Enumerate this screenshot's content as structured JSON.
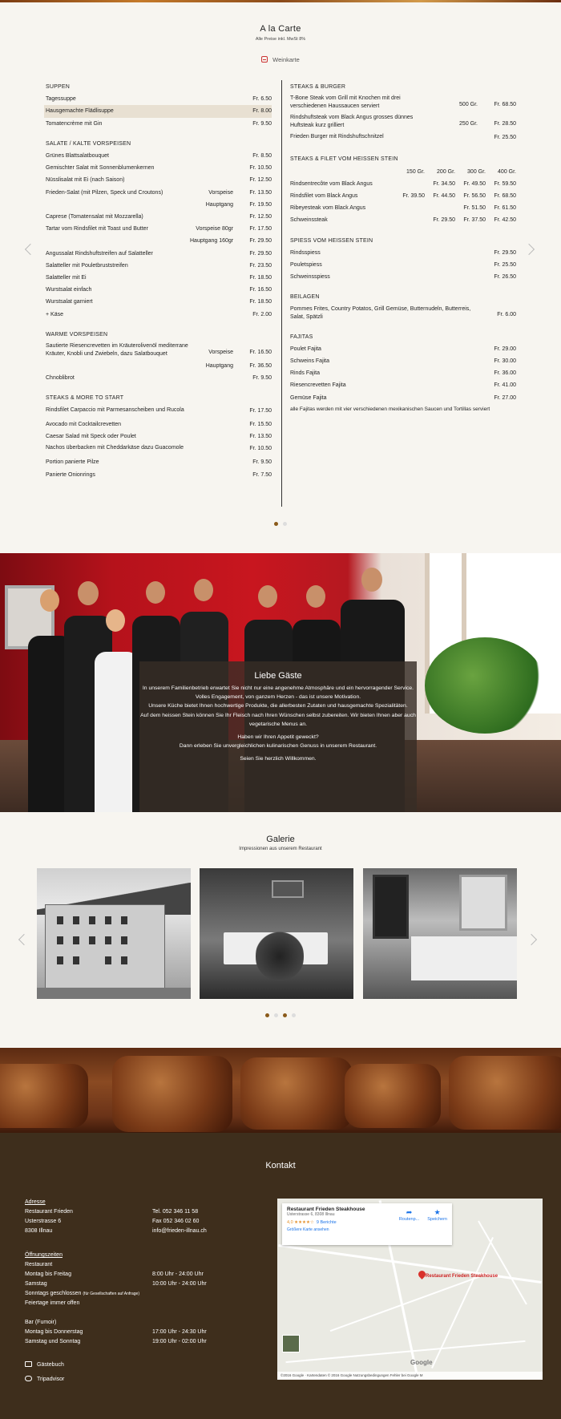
{
  "menu": {
    "title": "A la Carte",
    "subtitle": "Alle Preise inkl. MwSt 8%",
    "wine_link": "Weinkarte",
    "left": [
      {
        "heading": "SUPPEN",
        "rows": [
          {
            "name": "Tagessuppe",
            "price": "Fr.  6.50"
          },
          {
            "name": "Hausgemachte Flädlisuppe",
            "price": "Fr.  8.00",
            "highlight": true
          },
          {
            "name": "Tomatencrème mit Gin",
            "price": "Fr.  9.50"
          }
        ]
      },
      {
        "heading": "SALATE / KALTE VORSPEISEN",
        "rows": [
          {
            "name": "Grünes Blattsalatbouquet",
            "price": "Fr.  8.50"
          },
          {
            "name": "Gemischter Salat mit Sonnenblumenkernen",
            "price": "Fr. 10.50"
          },
          {
            "name": "Nüsslisalat mit Ei (nach Saison)",
            "price": "Fr. 12.50"
          },
          {
            "name": "Frieden-Salat (mit Pilzen, Speck und Croutons)",
            "variant": "Vorspeise",
            "price": "Fr. 13.50"
          },
          {
            "name": "",
            "variant": "Hauptgang",
            "price": "Fr. 19.50"
          },
          {
            "name": "Caprese (Tomatensalat mit Mozzarella)",
            "price": "Fr. 12.50"
          },
          {
            "name": "Tartar vom Rindsfilet mit Toast und Butter",
            "variant": "Vorspeise  80gr",
            "price": "Fr. 17.50"
          },
          {
            "name": "",
            "variant": "Hauptgang 160gr",
            "price": "Fr. 29.50"
          },
          {
            "name": "Angussalat Rindshuftstreifen auf Salatteller",
            "price": "Fr. 29.50"
          },
          {
            "name": "Salatteller mit Pouletbruststreifen",
            "price": "Fr. 23.50"
          },
          {
            "name": "Salatteller mit Ei",
            "price": "Fr. 18.50"
          },
          {
            "name": "Wurstsalat einfach",
            "price": "Fr. 16.50"
          },
          {
            "name": "Wurstsalat garniert",
            "price": "Fr. 18.50"
          },
          {
            "name": "+ Käse",
            "price": "Fr.  2.00"
          }
        ]
      },
      {
        "heading": "WARME VORSPEISEN",
        "rows": [
          {
            "name": "Sautierte Riesencrevetten im Kräuterolivenöl mediterrane Kräuter, Knobli und Zwiebeln, dazu Salatbouquet",
            "variant": "Vorspeise",
            "price": "Fr. 16.50",
            "multiline": true
          },
          {
            "name": "",
            "variant": "Hauptgang",
            "price": "Fr. 36.50"
          },
          {
            "name": "Chnoblibrot",
            "price": "Fr.  9.50"
          }
        ]
      },
      {
        "heading": "STEAKS & MORE TO START",
        "rows": [
          {
            "name": "Rindsfilet Carpaccio mit Parmesanscheiben und Rucola",
            "price": "Fr. 17.50",
            "multiline": true
          },
          {
            "name": "Avocado mit Cocktailcrevetten",
            "price": "Fr. 15.50"
          },
          {
            "name": "Caesar Salad mit Speck oder Poulet",
            "price": "Fr. 13.50"
          },
          {
            "name": "Nachos überbacken mit Cheddarkäse dazu Guacomole",
            "price": "Fr. 10.50",
            "multiline": true
          },
          {
            "name": "Portion panierte Pilze",
            "price": "Fr.  9.50"
          },
          {
            "name": "Panierte Onionrings",
            "price": "Fr.  7.50"
          }
        ]
      }
    ],
    "right": [
      {
        "heading": "STEAKS & BURGER",
        "rows": [
          {
            "name": "T-Bone Steak vom Grill mit Knochen mit drei verschiedenen Haussaucen serviert",
            "variant": "500 Gr.",
            "price": "Fr. 68.50",
            "multiline": true
          },
          {
            "name": "Rindshuftsteak vom Black Angus grosses dünnes Huftsteak kurz grilliert",
            "variant": "250 Gr.",
            "price": "Fr. 28.50",
            "multiline": true
          },
          {
            "name": "Frieden Burger mit Rindshuftschnitzel",
            "price": "Fr. 25.50",
            "multiline": true
          }
        ]
      },
      {
        "heading": "STEAKS & FILET VOM HEISSEN STEIN",
        "sizes": [
          "150 Gr.",
          "200 Gr.",
          "300 Gr.",
          "400 Gr."
        ],
        "rows4": [
          {
            "name": "Rindsentrecôte vom Black Angus",
            "p": [
              "",
              "Fr. 34.50",
              "Fr. 49.50",
              "Fr. 59.50"
            ]
          },
          {
            "name": "Rindsfilet vom Black Angus",
            "p": [
              "Fr. 39.50",
              "Fr. 44.50",
              "Fr. 56.50",
              "Fr. 68.50"
            ]
          },
          {
            "name": "Ribeyesteak vom Black Angus",
            "p": [
              "",
              "",
              "Fr. 51.50",
              "Fr. 61.50"
            ]
          },
          {
            "name": "Schweinssteak",
            "p": [
              "",
              "Fr. 29.50",
              "Fr. 37.50",
              "Fr. 42.50"
            ]
          }
        ]
      },
      {
        "heading": "SPIESS VOM HEISSEN STEIN",
        "rows": [
          {
            "name": "Rindsspiess",
            "price": "Fr. 29.50"
          },
          {
            "name": "Pouletspiess",
            "price": "Fr. 25.50"
          },
          {
            "name": "Schweinsspiess",
            "price": "Fr. 26.50"
          }
        ]
      },
      {
        "heading": "BEILAGEN",
        "rows": [
          {
            "name": "Pommes Frites, Country Potatos, Grill Gemüse, Butternudeln, Butterreis, Salat, Spätzli",
            "price": "Fr.  6.00",
            "multiline": true
          }
        ]
      },
      {
        "heading": "FAJITAS",
        "rows": [
          {
            "name": "Poulet Fajita",
            "price": "Fr. 29.00"
          },
          {
            "name": "Schweins Fajita",
            "price": "Fr. 30.00"
          },
          {
            "name": "Rinds Fajita",
            "price": "Fr. 36.00"
          },
          {
            "name": "Riesencrevetten Fajita",
            "price": "Fr. 41.00"
          },
          {
            "name": "Gemüse Fajita",
            "price": "Fr. 27.00"
          }
        ],
        "note": "alle Fajitas werden mit vier verschiedenen mexikanischen Saucen und Tortillas serviert"
      }
    ]
  },
  "welcome": {
    "title": "Liebe Gäste",
    "paragraphs": [
      "In unserem Familienbetrieb erwartet Sie nicht nur eine angenehme Atmosphäre und ein hervorragender Service.",
      "Volles Engagement, von ganzem Herzen - das ist unsere Motivation.",
      "Unsere Küche bietet Ihnen hochwertige Produkte, die allerbesten Zutaten und hausgemachte Spezialitäten.",
      "Auf dem heissen Stein können Sie Ihr Fleisch nach Ihren Wünschen selbst zubereiten. Wir bieten Ihnen aber auch vegetarische Menus an.",
      "Haben wir Ihren Appetit geweckt?",
      "Dann erleben Sie unvergleichlichen kulinarischen Genuss in unserem Restaurant.",
      "Seien Sie herzlich Willkommen."
    ]
  },
  "gallery": {
    "title": "Galerie",
    "subtitle": "Impressionen aus unserem Restaurant"
  },
  "contact": {
    "title": "Kontakt",
    "address_label": "Adresse",
    "name": "Restaurant Frieden",
    "street": "Usterstrasse 6",
    "city": "8308 Illnau",
    "tel": "Tel. 052 346 11 58",
    "fax": "Fax 052 346 02 60",
    "email": "info@frieden-illnau.ch",
    "hours_label": "Öffnungszeiten",
    "restaurant_label": "Restaurant",
    "mo_fr": "Montag bis Freitag",
    "mo_fr_time": "8:00 Uhr - 24:00 Uhr",
    "sa": "Samstag",
    "sa_time": "10:00 Uhr - 24:00 Uhr",
    "so_closed": "Sonntags geschlossen",
    "so_note": "(für Gesellschaften auf Anfrage)",
    "feiertage": "Feiertage immer offen",
    "bar_label": "Bar (Fumoir)",
    "bar_mo_do": "Montag bis Donnerstag",
    "bar_mo_do_time": "17:00 Uhr - 24:30 Uhr",
    "bar_sa_so": "Samstag und Sonntag",
    "bar_sa_so_time": "19:00 Uhr - 02:00 Uhr",
    "guestbook": "Gästebuch",
    "tripadvisor": "Tripadvisor"
  },
  "map": {
    "place": "Restaurant Frieden Steakhouse",
    "address": "Usterstrasse 6, 8308 Illnau",
    "rating": "4,0 ★★★★☆",
    "reviews": "9 Berichte",
    "larger": "Größere Karte ansehen",
    "route": "Routenp...",
    "save": "Speichern",
    "pin_label": "Restaurant Frieden Steakhouse",
    "footer": "©2016 Google · Kartendaten © 2016 Google   Nutzungsbedingungen   Fehler bei Google M",
    "google": "Google"
  }
}
